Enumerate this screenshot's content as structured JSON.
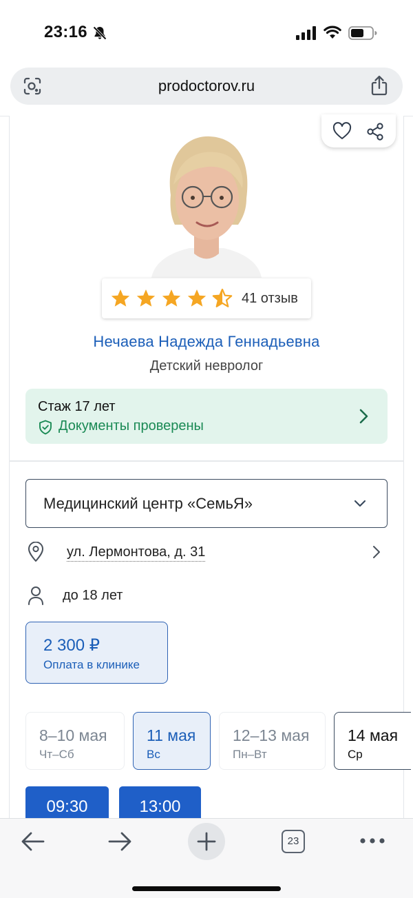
{
  "status_bar": {
    "time": "23:16"
  },
  "browser": {
    "url": "prodoctorov.ru",
    "tabs_count": "23"
  },
  "doctor": {
    "rating": 4.5,
    "max_rating": 5,
    "reviews_label": "41 отзыв",
    "name": "Нечаева Надежда Геннадьевна",
    "specialty": "Детский невролог",
    "experience": "Стаж 17 лет",
    "documents_status": "Документы проверены"
  },
  "clinic": {
    "selected": "Медицинский центр «СемьЯ»",
    "address": "ул. Лермонтова, д. 31",
    "age_limit": "до 18 лет",
    "price": "2 300 ₽",
    "payment_note": "Оплата в клинике"
  },
  "dates": [
    {
      "main": "8–10 мая",
      "sub": "Чт–Сб",
      "state": "disabled"
    },
    {
      "main": "11 мая",
      "sub": "Вс",
      "state": "selected"
    },
    {
      "main": "12–13 мая",
      "sub": "Пн–Вт",
      "state": "disabled"
    },
    {
      "main": "14 мая",
      "sub": "Ср",
      "state": "active"
    }
  ],
  "time_slots": [
    "09:30",
    "13:00"
  ],
  "colors": {
    "accent_blue": "#1b5eb8",
    "slot_blue": "#1f5fc8",
    "verified_green": "#1b8a55",
    "star_orange": "#f5a623",
    "experience_bg": "#e2f4ec"
  }
}
